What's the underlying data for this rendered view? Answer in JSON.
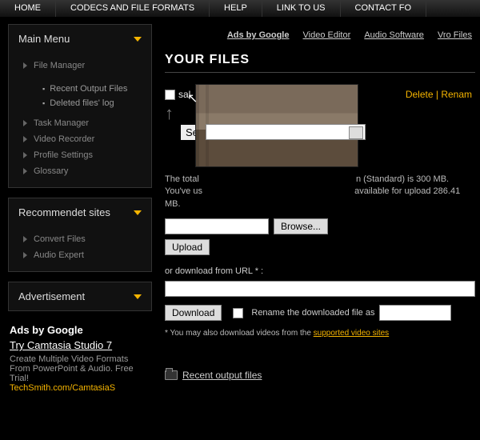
{
  "topnav": [
    "HOME",
    "CODECS AND FILE FORMATS",
    "HELP",
    "LINK TO US",
    "CONTACT FO"
  ],
  "sidebar": {
    "main_menu_title": "Main Menu",
    "items": [
      {
        "label": "File Manager"
      },
      {
        "label": "Task Manager"
      },
      {
        "label": "Video Recorder"
      },
      {
        "label": "Profile Settings"
      },
      {
        "label": "Glossary"
      }
    ],
    "file_manager_sub": [
      "Recent Output Files",
      "Deleted files' log"
    ],
    "recommended_title": "Recommendet sites",
    "recommended": [
      "Convert Files",
      "Audio Expert"
    ],
    "advert_title": "Advertisement",
    "ad": {
      "adsby": "Ads by Google",
      "headline": "Try Camtasia Studio 7",
      "body": "Create Multiple Video Formats From PowerPoint & Audio. Free Trial!",
      "url": "TechSmith.com/CamtasiaS"
    }
  },
  "toplinks": {
    "adsby": "Ads by Google",
    "links": [
      "Video Editor",
      "Audio Software",
      "Vro Files"
    ]
  },
  "page_title": "YOUR FILES",
  "actions": {
    "delete": "Delete",
    "rename": "Renam"
  },
  "sal_label": "sal",
  "select_label": "Sel",
  "quota_line1": "The total",
  "quota_line1b": "n (Standard) is 300 MB.",
  "quota_line2": "You've us",
  "quota_line2b": "available for upload 286.41 MB.",
  "browse_btn": "Browse...",
  "upload_btn": "Upload",
  "or_url_label": "or download from URL * :",
  "download_btn": "Download",
  "rename_cb_label": "Rename the downloaded file as",
  "note_prefix": "* You may also download videos from the ",
  "note_link": "supported video sites",
  "recent_link": "Recent output files"
}
